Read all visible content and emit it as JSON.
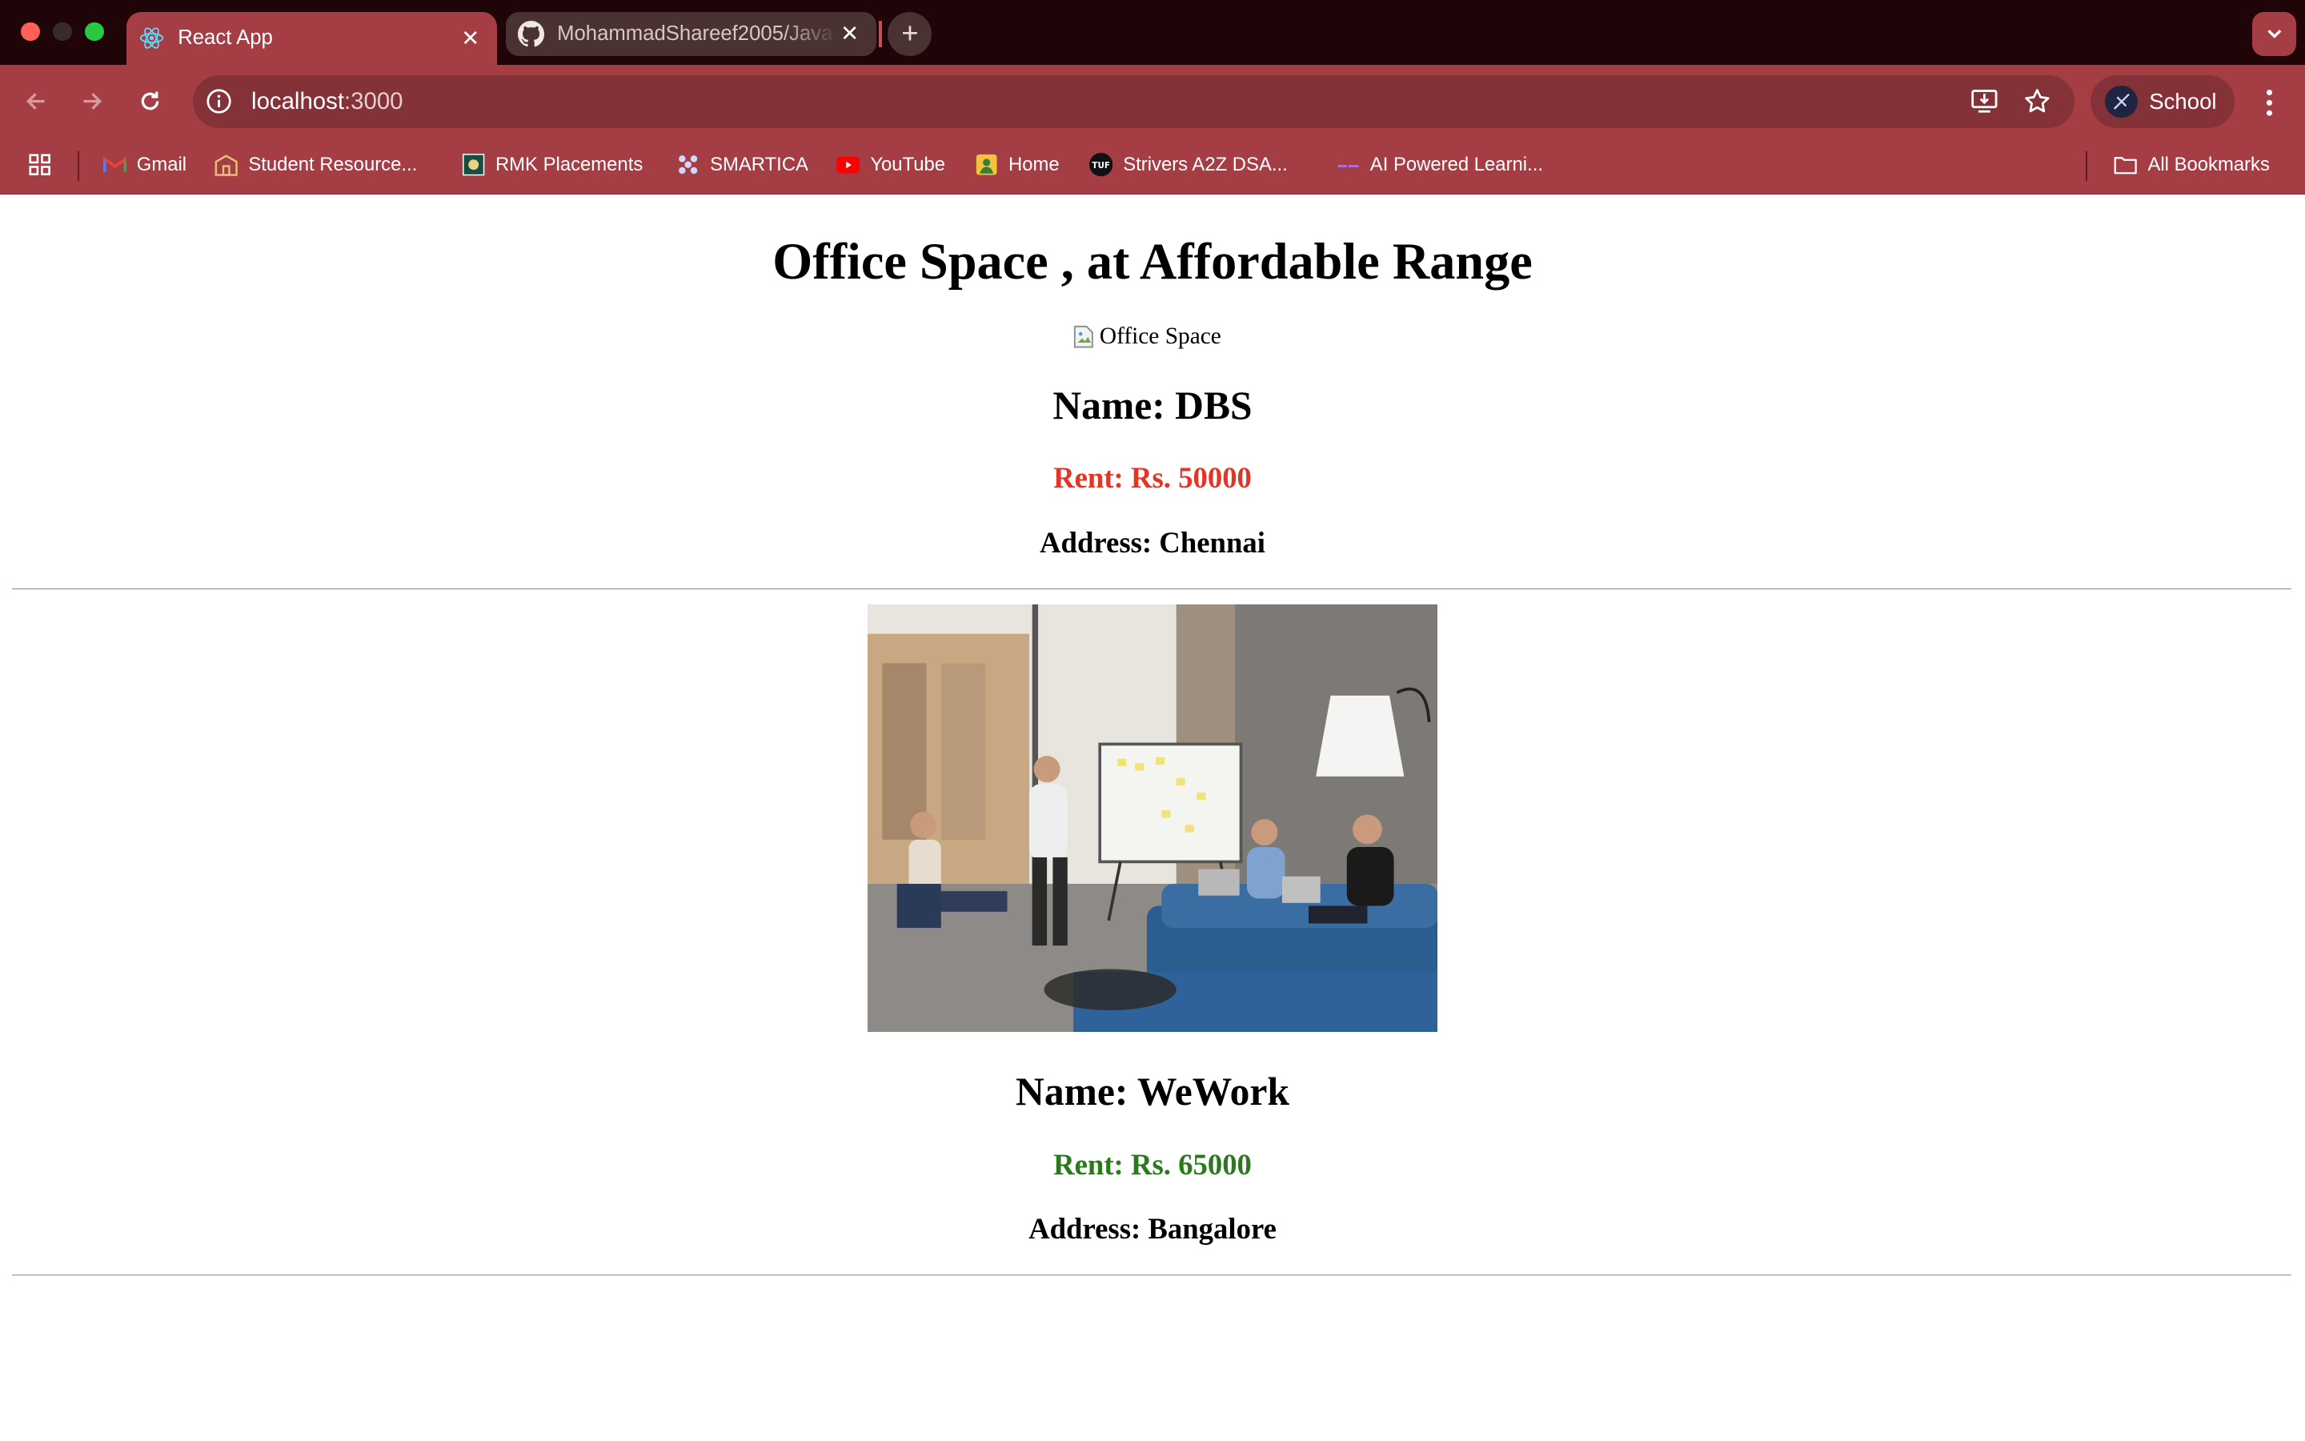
{
  "browser": {
    "tabs": [
      {
        "title": "React App",
        "active": true,
        "icon": "react-icon"
      },
      {
        "title": "MohammadShareef2005/Java",
        "active": false,
        "icon": "github-icon"
      }
    ],
    "new_tab_label": "+",
    "address": {
      "host": "localhost",
      "port": ":3000"
    },
    "profile_name": "School",
    "accent_color": "#a53d45",
    "bookmarks": [
      {
        "label": "Gmail",
        "icon": "gmail-icon"
      },
      {
        "label": "Student Resource...",
        "icon": "school-icon"
      },
      {
        "label": "RMK Placements",
        "icon": "rmk-icon"
      },
      {
        "label": "SMARTICA",
        "icon": "smartica-icon"
      },
      {
        "label": "YouTube",
        "icon": "youtube-icon"
      },
      {
        "label": "Home",
        "icon": "home-app-icon"
      },
      {
        "label": "Strivers A2Z DSA...",
        "icon": "tuf-icon"
      },
      {
        "label": "AI Powered Learni...",
        "icon": "ai-icon"
      }
    ],
    "all_bookmarks_label": "All Bookmarks"
  },
  "page": {
    "heading": "Office Space , at Affordable Range",
    "offices": [
      {
        "image_alt": "Office Space",
        "image_loaded": false,
        "name": "Name: DBS",
        "rent": "Rent: Rs. 50000",
        "rent_color": "#e53424",
        "address": "Address: Chennai"
      },
      {
        "image_alt": "Office Space",
        "image_loaded": true,
        "name": "Name: WeWork",
        "rent": "Rent: Rs. 65000",
        "rent_color": "#2a7a1c",
        "address": "Address: Bangalore"
      }
    ]
  }
}
